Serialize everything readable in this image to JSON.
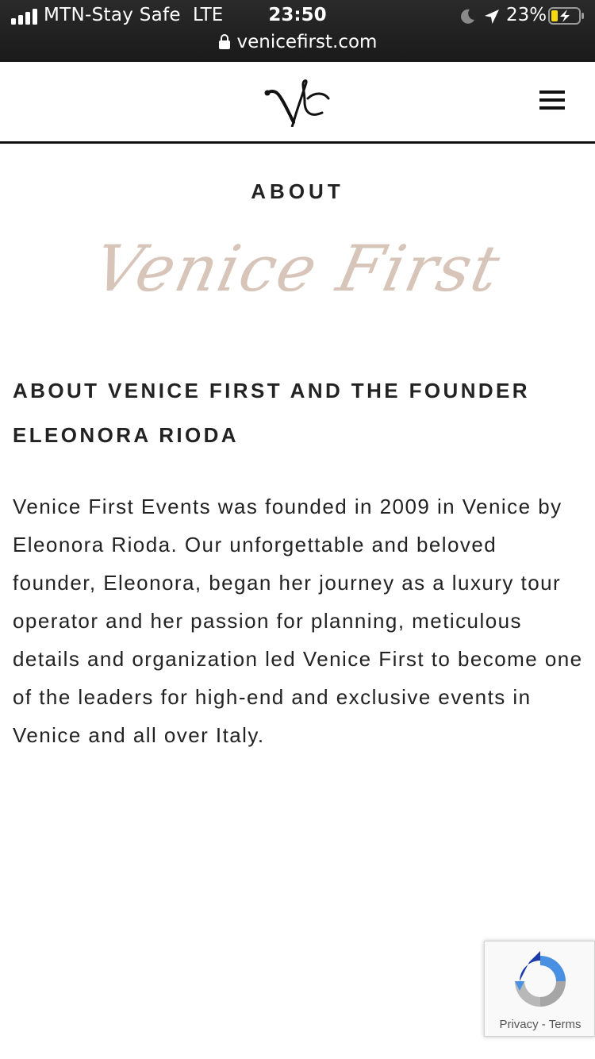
{
  "status_bar": {
    "carrier": "MTN-Stay Safe",
    "network": "LTE",
    "time": "23:50",
    "battery": "23%",
    "url": "venicefirst.com"
  },
  "header": {
    "logo_icon": "vf-monogram-logo",
    "menu_icon": "hamburger-menu-icon"
  },
  "page": {
    "eyebrow": "ABOUT",
    "script_title": "Venice First",
    "heading_line1": "ABOUT VENICE FIRST AND THE FOUNDER",
    "heading_line2": "ELEONORA RIODA",
    "body": "Venice First Events was founded in 2009 in Venice by Eleonora Rioda. Our unforgettable and beloved founder, Eleonora, began her journey as a luxury tour operator and her passion for planning, meticulous details and organization led Venice First to become one of the leaders for high-end and exclusive events in Venice and all over Italy."
  },
  "recaptcha": {
    "privacy": "Privacy",
    "separator": " - ",
    "terms": "Terms"
  },
  "colors": {
    "script_title": "#d8c5b9",
    "status_bar": "#1f1f1f",
    "battery_fill": "#f5d90a"
  }
}
